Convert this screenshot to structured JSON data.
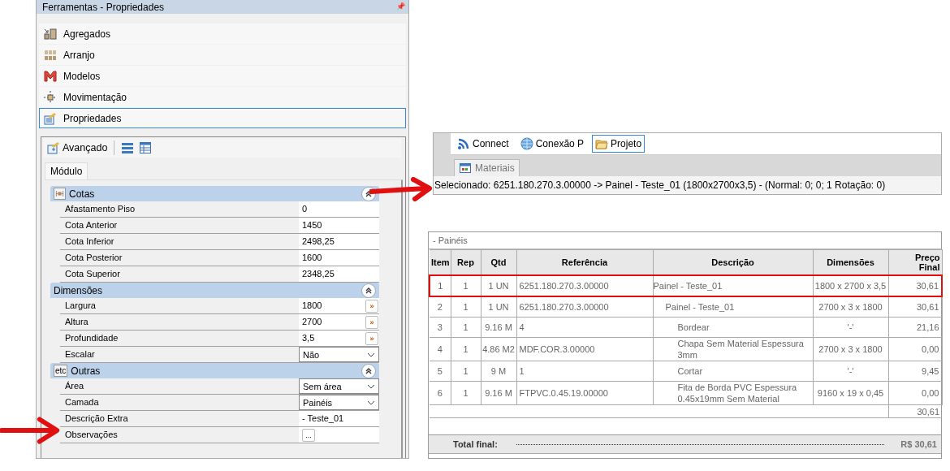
{
  "panel": {
    "title": "Ferramentas - Propriedades",
    "pin": "📌"
  },
  "menu": [
    {
      "label": "Agregados",
      "selected": false
    },
    {
      "label": "Arranjo",
      "selected": false
    },
    {
      "label": "Modelos",
      "selected": false
    },
    {
      "label": "Movimentação",
      "selected": false
    },
    {
      "label": "Propriedades",
      "selected": true
    }
  ],
  "toolbar": {
    "label": "Avançado"
  },
  "tabs": [
    {
      "label": "Módulo",
      "selected": true
    }
  ],
  "sections": [
    {
      "title": "Cotas",
      "expanded": true,
      "rows": [
        {
          "kind": "text",
          "label": "Afastamento Piso",
          "value": "0"
        },
        {
          "kind": "text",
          "label": "Cota Anterior",
          "value": "1450"
        },
        {
          "kind": "text",
          "label": "Cota Inferior",
          "value": "2498,25"
        },
        {
          "kind": "text",
          "label": "Cota Posterior",
          "value": "1600"
        },
        {
          "kind": "text",
          "label": "Cota Superior",
          "value": "2348,25"
        }
      ]
    },
    {
      "title": "Dimensões",
      "expanded": true,
      "rows": [
        {
          "kind": "spin",
          "label": "Largura",
          "value": "1800",
          "button": "»"
        },
        {
          "kind": "spin",
          "label": "Altura",
          "value": "2700",
          "button": "»"
        },
        {
          "kind": "spin",
          "label": "Profundidade",
          "value": "3,5",
          "button": "»"
        },
        {
          "kind": "dropdown",
          "label": "Escalar",
          "value": "Não"
        }
      ]
    },
    {
      "title": "Outras",
      "icon_text": "etc",
      "expanded": true,
      "rows": [
        {
          "kind": "dropdown",
          "label": "Área",
          "value": "Sem área"
        },
        {
          "kind": "dropdown",
          "label": "Camada",
          "value": "Painéis"
        },
        {
          "kind": "text",
          "label": "Descrição Extra",
          "value": "- Teste_01"
        },
        {
          "kind": "ellipsis",
          "label": "Observações",
          "value": "",
          "button": "..."
        }
      ]
    }
  ],
  "top_toolbar": [
    {
      "label": "Connect",
      "selected": false
    },
    {
      "label": "Conexão P",
      "selected": false
    },
    {
      "label": "Projeto",
      "selected": true
    }
  ],
  "doc_tabs": [
    {
      "label": "Materiais",
      "selected": true
    }
  ],
  "status": "Selecionado: 6251.180.270.3.00000 -> Painel - Teste_01 (1800x2700x3,5) - (Normal: 0; 0; 1 Rotação: 0)",
  "table": {
    "group": "- Painéis",
    "columns": [
      "Item",
      "Rep",
      "Qtd",
      "Referência",
      "Descrição",
      "Dimensões",
      "Preço Final"
    ],
    "rows": [
      {
        "item": "1",
        "rep": "1",
        "qtd": "1 UN",
        "ref": "6251.180.270.3.00000",
        "desc": "Painel - Teste_01",
        "dim": "1800 x 2700 x 3,5",
        "price": "30,61",
        "selected": true,
        "children": [
          {
            "item": "2",
            "rep": "1",
            "qtd": "1 UN",
            "ref": "6251.180.270.3.00000",
            "desc": "Painel - Teste_01",
            "dim": "2700 x 3 x 1800",
            "price": "30,61",
            "selected": false,
            "children": [
              {
                "item": "3",
                "rep": "1",
                "qtd": "9.16 M",
                "ref": "4",
                "desc": "Bordear",
                "dim": "'-'",
                "price": "21,16",
                "selected": false
              },
              {
                "item": "4",
                "rep": "1",
                "qtd": "4.86 M2",
                "ref": "MDF.COR.3.00000",
                "desc": "Chapa Sem Material Espessura 3mm",
                "dim": "2700 x 3 x 1800",
                "price": "0,00",
                "selected": false
              },
              {
                "item": "5",
                "rep": "1",
                "qtd": "9 M",
                "ref": "1",
                "desc": "Cortar",
                "dim": "'-'",
                "price": "9,45",
                "selected": false
              },
              {
                "item": "6",
                "rep": "1",
                "qtd": "9.16 M",
                "ref": "FTPVC.0.45.19.00000",
                "desc": "Fita de Borda PVC Espessura 0.45x19mm Sem Material",
                "dim": "9160 x 19 x 0,45",
                "price": "0,00",
                "selected": false
              }
            ]
          }
        ]
      }
    ],
    "subtotal": "30,61",
    "total_label": "Total final:",
    "total": "R$ 30,61"
  }
}
